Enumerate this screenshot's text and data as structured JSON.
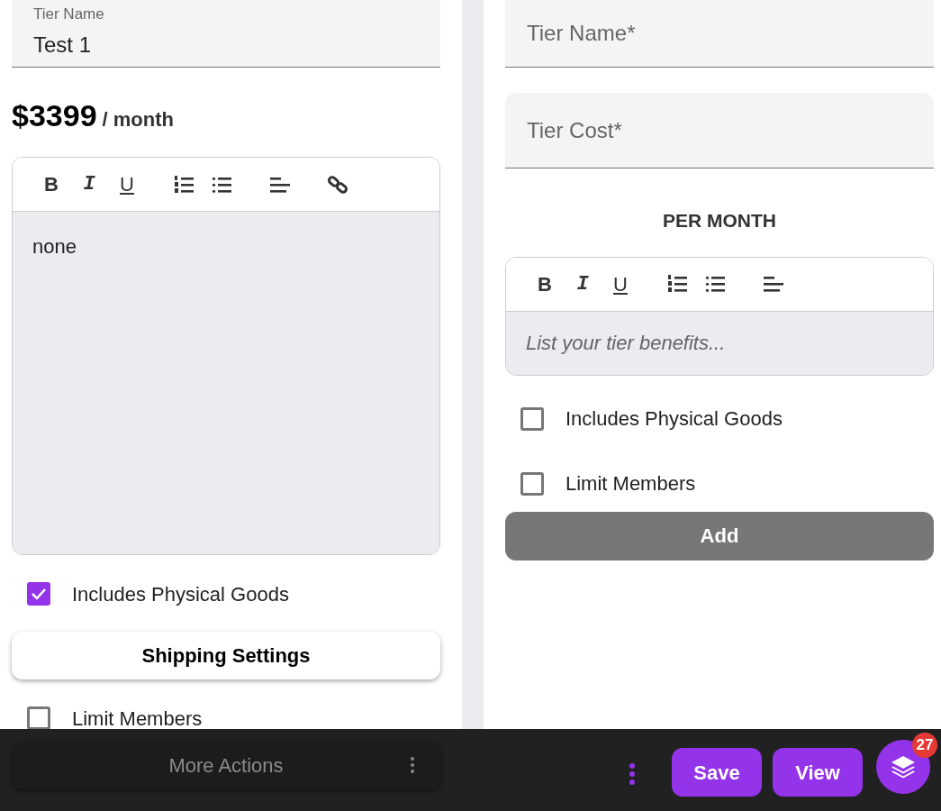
{
  "left_tier": {
    "name_field": {
      "label": "Tier Name",
      "value": "Test 1"
    },
    "price": "$3399",
    "period": "/ month",
    "editor": {
      "toolbar": [
        {
          "kind": "bold",
          "glyph": "B"
        },
        {
          "kind": "italic",
          "glyph": "I"
        },
        {
          "kind": "underline",
          "glyph": "U"
        },
        {
          "kind": "ordered-list"
        },
        {
          "kind": "bullet-list"
        },
        {
          "kind": "align"
        },
        {
          "kind": "link"
        }
      ],
      "content": "none"
    },
    "items": [
      {
        "kind": "checkbox",
        "label": "Includes Physical Goods",
        "checked": true
      },
      {
        "kind": "button",
        "label": "Shipping Settings"
      },
      {
        "kind": "checkbox",
        "label": "Limit Members",
        "checked": false
      }
    ]
  },
  "new_tier": {
    "fields": [
      {
        "placeholder": "Tier Name*"
      },
      {
        "placeholder": "Tier Cost*"
      }
    ],
    "period_label": "PER MONTH",
    "editor": {
      "toolbar": [
        {
          "kind": "bold",
          "glyph": "B"
        },
        {
          "kind": "italic",
          "glyph": "I"
        },
        {
          "kind": "underline",
          "glyph": "U"
        },
        {
          "kind": "ordered-list"
        },
        {
          "kind": "bullet-list"
        },
        {
          "kind": "align"
        }
      ],
      "placeholder": "List your tier benefits..."
    },
    "items": [
      {
        "kind": "checkbox",
        "label": "Includes Physical Goods",
        "checked": false
      },
      {
        "kind": "checkbox",
        "label": "Limit Members",
        "checked": false
      }
    ],
    "add_button": {
      "label": "Add",
      "disabled": true
    }
  },
  "bottom_bar": {
    "more_actions": "More Actions",
    "buttons": [
      "Save",
      "View"
    ],
    "badge": "27"
  }
}
